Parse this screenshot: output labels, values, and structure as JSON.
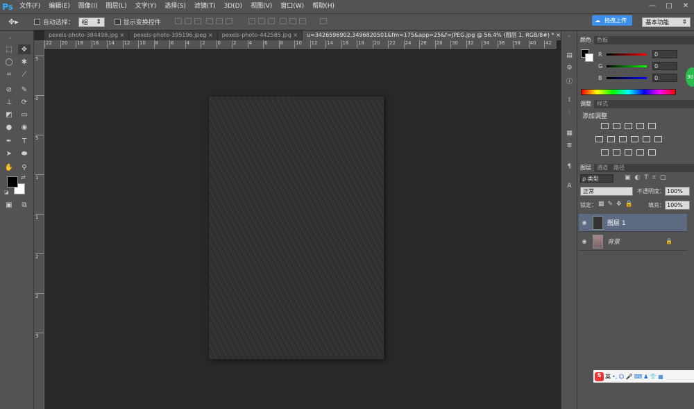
{
  "app": {
    "logo": "Ps"
  },
  "menu": [
    "文件(F)",
    "编辑(E)",
    "图像(I)",
    "图层(L)",
    "文字(Y)",
    "选择(S)",
    "滤镜(T)",
    "3D(D)",
    "视图(V)",
    "窗口(W)",
    "帮助(H)"
  ],
  "window_controls": {
    "minimize": "—",
    "restore": "□",
    "close": "✕"
  },
  "options": {
    "auto_select_label": "自动选择：",
    "auto_select_value": "组",
    "show_transform_label": "显示变换控件"
  },
  "baidu_badge": "拖拽上传",
  "workspace": "基本功能",
  "tabs": [
    {
      "label": "pexels-photo-384498.jpg",
      "close": "×"
    },
    {
      "label": "pexels-photo-395196.jpeg",
      "close": "×"
    },
    {
      "label": "pexels-photo-442585.jpg",
      "close": "×"
    },
    {
      "label": "u=3426596902,3496820501&fm=175&app=25&f=JPEG.jpg @ 56.4% (图层 1, RGB/8#) *",
      "close": "×"
    }
  ],
  "hruler_ticks": [
    "22",
    "20",
    "18",
    "16",
    "14",
    "12",
    "10",
    "8",
    "6",
    "4",
    "2",
    "0",
    "2",
    "4",
    "6",
    "8",
    "10",
    "12",
    "14",
    "16",
    "18",
    "20",
    "22",
    "24",
    "26",
    "28",
    "30",
    "32",
    "34",
    "36",
    "38",
    "40",
    "42"
  ],
  "vruler_ticks": [
    "5",
    "0",
    "5",
    "1",
    "1",
    "2",
    "2",
    "3"
  ],
  "colors": {
    "foreground": "#000000",
    "background": "#ffffff",
    "panel": "#535353",
    "canvas_bg": "#282828",
    "accent_blue": "#3d8ee6"
  },
  "color_panel": {
    "tabs": [
      "颜色",
      "色板"
    ],
    "channels": [
      {
        "name": "R",
        "value": "0"
      },
      {
        "name": "G",
        "value": "0"
      },
      {
        "name": "B",
        "value": "0"
      }
    ]
  },
  "adjust_panel": {
    "tabs": [
      "调整",
      "样式"
    ],
    "title": "添加调整"
  },
  "layers_panel": {
    "tabs": [
      "图层",
      "通道",
      "路径"
    ],
    "filter_label": "ρ 类型",
    "blend_mode": "正常",
    "opacity_label": "不透明度：",
    "opacity_value": "100%",
    "lock_label": "锁定：",
    "fill_label": "填充：",
    "fill_value": "100%",
    "layers": [
      {
        "name": "图层 1",
        "selected": true
      },
      {
        "name": "背景",
        "selected": false
      }
    ]
  },
  "taskbar": {
    "ime": "英"
  },
  "green_indicator": "30"
}
